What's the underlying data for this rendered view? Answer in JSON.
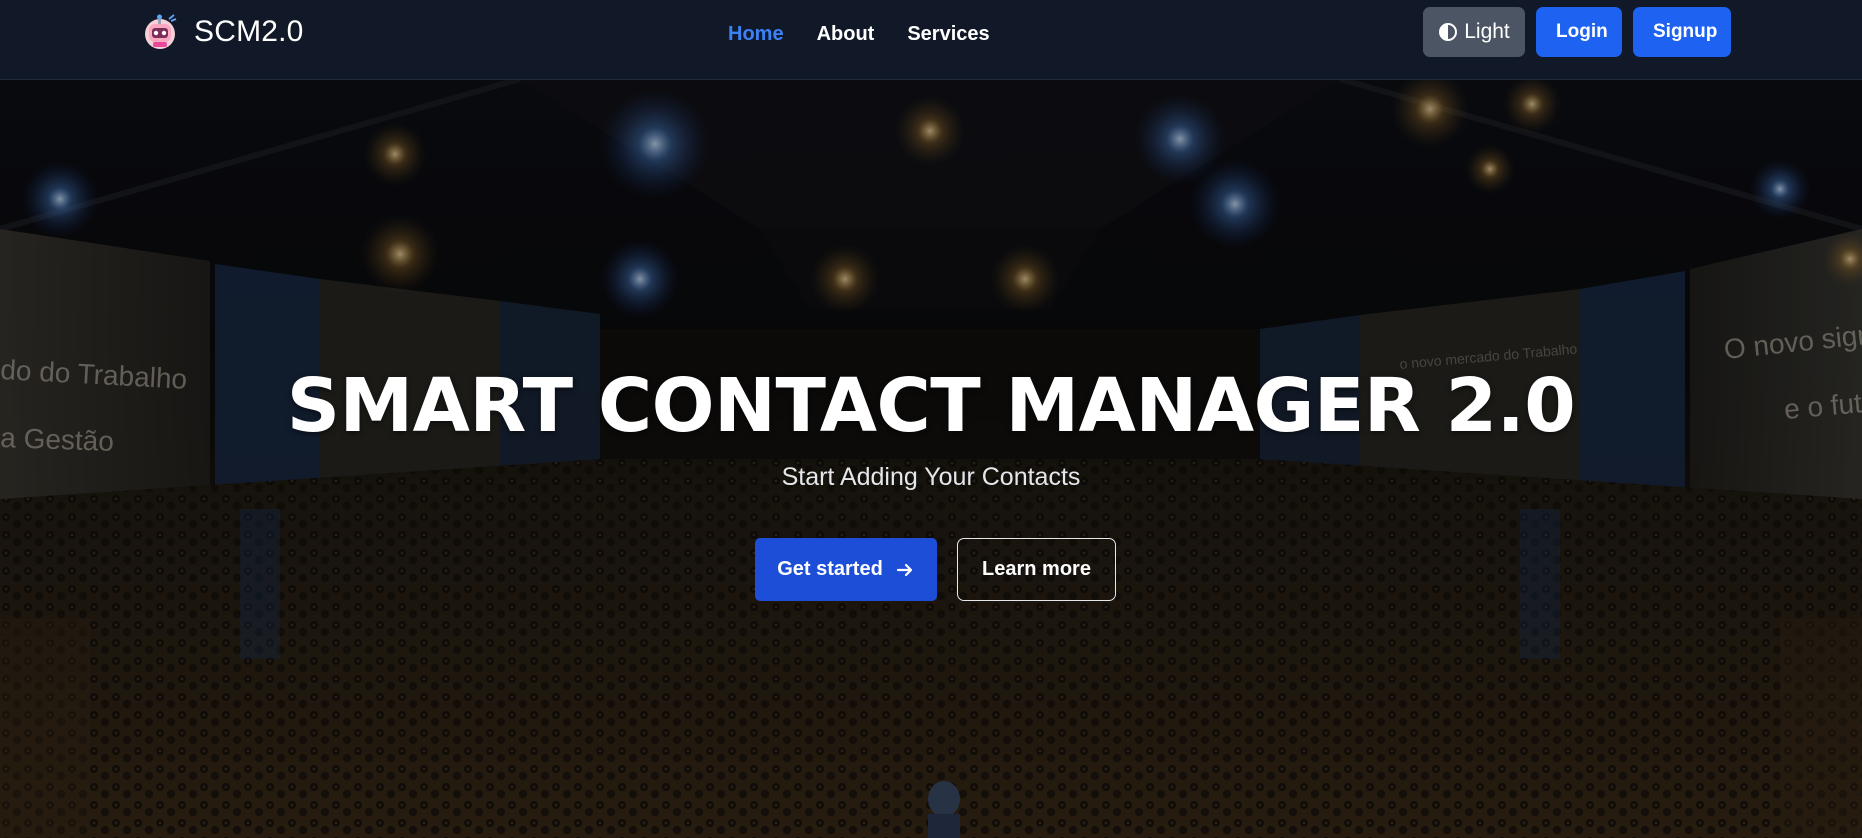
{
  "brand": {
    "name": "SCM2.0",
    "logo_icon": "robot-mascot-icon"
  },
  "nav": {
    "links": [
      {
        "label": "Home",
        "active": true
      },
      {
        "label": "About",
        "active": false
      },
      {
        "label": "Services",
        "active": false
      }
    ]
  },
  "actions": {
    "theme_toggle_label": "Light",
    "theme_icon": "half-circle-contrast-icon",
    "login_label": "Login",
    "signup_label": "Signup"
  },
  "hero": {
    "title": "SMART CONTACT MANAGER 2.0",
    "subtitle": "Start Adding Your Contacts",
    "primary_button_label": "Get started",
    "primary_button_icon": "arrow-right-icon",
    "secondary_button_label": "Learn more",
    "background": "conference-audience-photo"
  },
  "colors": {
    "navbar_bg": "#111827",
    "active_link": "#3b82f6",
    "primary_button": "#1d4ed8",
    "auth_button": "#1d62f0",
    "theme_button": "#4b5563"
  }
}
